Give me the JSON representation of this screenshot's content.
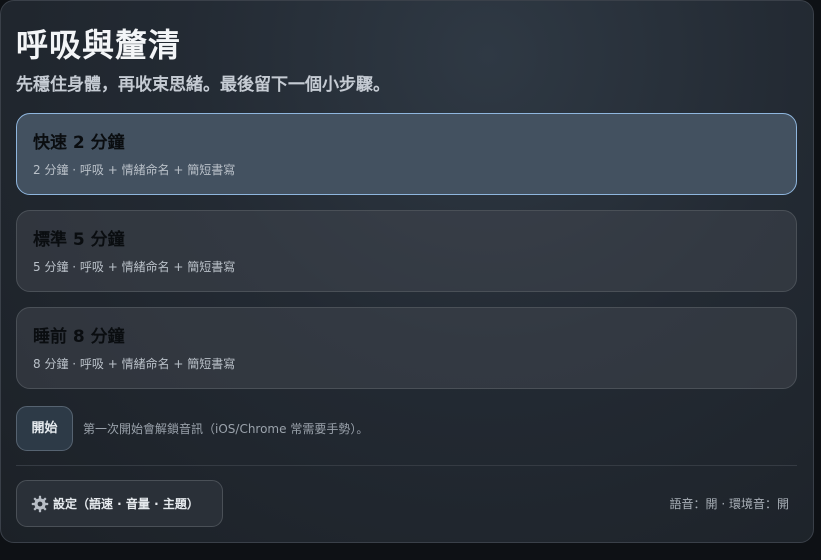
{
  "page": {
    "title": "呼吸與釐清",
    "subtitle": "先穩住身體，再收束思緒。最後留下一個小步驟。"
  },
  "options": [
    {
      "title": "快速 2 分鐘",
      "desc": "2 分鐘 · 呼吸 + 情緒命名 + 簡短書寫",
      "selected": true
    },
    {
      "title": "標準 5 分鐘",
      "desc": "5 分鐘 · 呼吸 + 情緒命名 + 簡短書寫",
      "selected": false
    },
    {
      "title": "睡前 8 分鐘",
      "desc": "8 分鐘 · 呼吸 + 情緒命名 + 簡短書寫",
      "selected": false
    }
  ],
  "actions": {
    "start_label": "開始",
    "start_hint": "第一次開始會解鎖音訊（iOS/Chrome 常需要手勢）。"
  },
  "footer": {
    "settings_label": "設定（語速 · 音量 · 主題）",
    "settings_icon": "gear-icon",
    "status": "語音：開 · 環境音：開"
  },
  "colors": {
    "accent": "#8fb6de",
    "selected_bg": "#435160",
    "background": "#1c2127"
  }
}
